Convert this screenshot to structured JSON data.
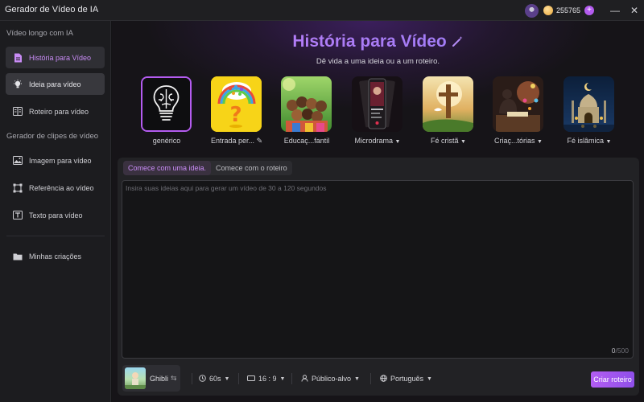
{
  "app": {
    "title": "Gerador de Vídeo de IA",
    "credits": "255765",
    "plus": "+",
    "minimize": "—",
    "close": "✕"
  },
  "sidebar": {
    "section1": "Vídeo longo com IA",
    "section2": "Gerador de clipes de vídeo",
    "items": [
      {
        "label": "História para Vídeo",
        "icon": "document-icon"
      },
      {
        "label": "Ideia para vídeo",
        "icon": "lightbulb-icon"
      },
      {
        "label": "Roteiro para vídeo",
        "icon": "script-icon"
      },
      {
        "label": "Imagem para vídeo",
        "icon": "image-icon"
      },
      {
        "label": "Referência ao vídeo",
        "icon": "reference-icon"
      },
      {
        "label": "Texto para vídeo",
        "icon": "text-icon"
      },
      {
        "label": "Minhas criações",
        "icon": "folder-icon"
      }
    ]
  },
  "hero": {
    "title": "História para Vídeo",
    "subtitle": "Dê vida a uma ideia ou a um roteiro."
  },
  "templates": [
    {
      "label": "genérico"
    },
    {
      "label": "Entrada per..."
    },
    {
      "label": "Educaç...fantil"
    },
    {
      "label": "Microdrama"
    },
    {
      "label": "Fé cristã"
    },
    {
      "label": "Criaç...tórias"
    },
    {
      "label": "Fé islâmica"
    }
  ],
  "input": {
    "tabs": [
      "Comece com uma ideia.",
      "Comece com o roteiro"
    ],
    "placeholder": "Insira suas ideias aqui para gerar um vídeo de 30 a 120 segundos",
    "count": "0",
    "max": "/500"
  },
  "options": {
    "style": "Ghibli",
    "duration": "60s",
    "ratio": "16 : 9",
    "audience": "Público-alvo",
    "language": "Português",
    "create": "Criar roteiro"
  },
  "colors": {
    "accent": "#b45cf0",
    "active_text": "#c98cf6"
  }
}
